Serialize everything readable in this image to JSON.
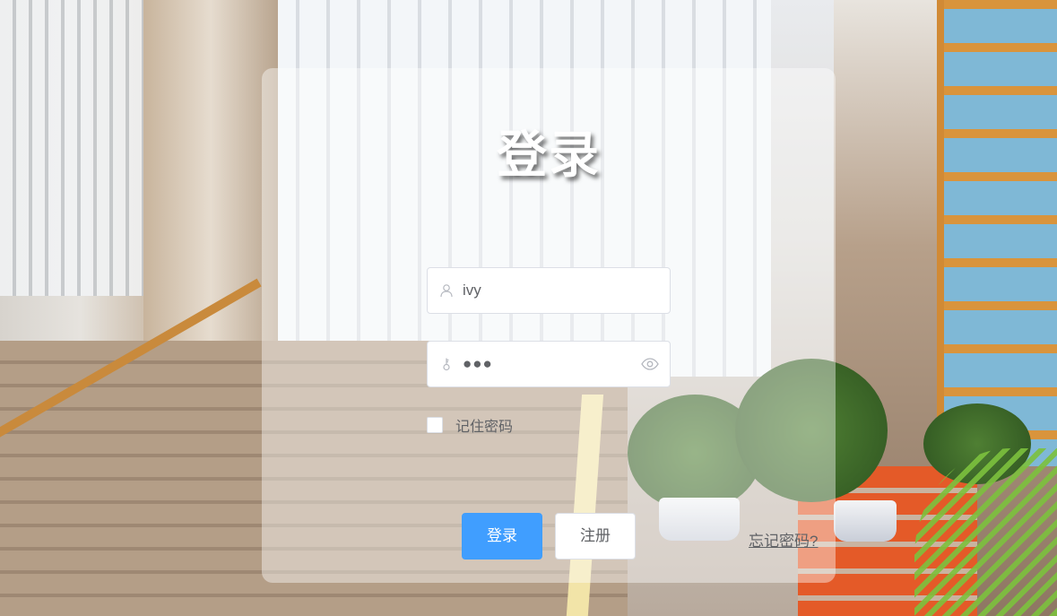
{
  "login": {
    "title": "登录",
    "username": {
      "value": "ivy",
      "icon": "user-icon"
    },
    "password": {
      "masked_value": "●●●",
      "prefix_icon": "key-icon",
      "suffix_icon": "eye-icon"
    },
    "remember_label": "记住密码",
    "remember_checked": false,
    "login_button": "登录",
    "register_button": "注册",
    "forgot_link": "忘记密码?"
  },
  "colors": {
    "primary": "#409eff",
    "card_background": "rgba(255,255,255,0.42)",
    "text": "#606266",
    "border": "#dcdfe6"
  }
}
